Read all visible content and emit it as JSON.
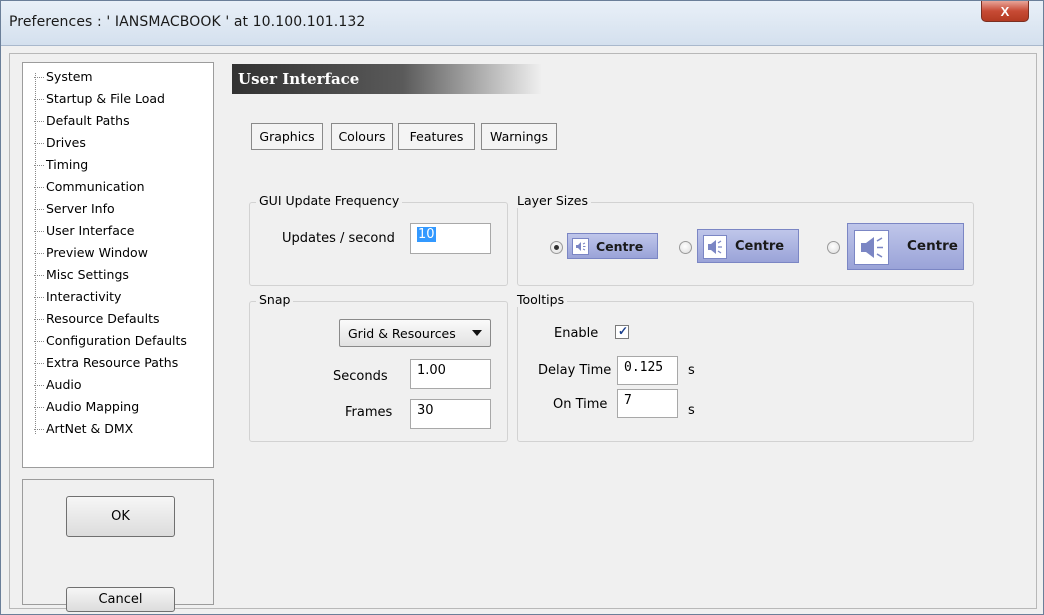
{
  "window": {
    "title": "Preferences  :  ' IANSMACBOOK '  at  10.100.101.132",
    "close_label": "X"
  },
  "tree": {
    "items": [
      "System",
      "Startup & File Load",
      "Default Paths",
      "Drives",
      "Timing",
      "Communication",
      "Server Info",
      "User Interface",
      "Preview Window",
      "Misc Settings",
      "Interactivity",
      "Resource Defaults",
      "Configuration Defaults",
      "Extra Resource Paths",
      "Audio",
      "Audio Mapping",
      "ArtNet & DMX"
    ]
  },
  "buttons": {
    "ok": "OK",
    "cancel": "Cancel"
  },
  "header": {
    "title": "User Interface"
  },
  "tabs": [
    {
      "label": "Graphics"
    },
    {
      "label": "Colours"
    },
    {
      "label": "Features"
    },
    {
      "label": "Warnings"
    }
  ],
  "gui_update": {
    "group_label": "GUI Update Frequency",
    "field_label": "Updates / second",
    "value": "10"
  },
  "layer_sizes": {
    "group_label": "Layer Sizes",
    "options": [
      {
        "label": "Centre",
        "selected": true
      },
      {
        "label": "Centre",
        "selected": false
      },
      {
        "label": "Centre",
        "selected": false
      }
    ]
  },
  "snap": {
    "group_label": "Snap",
    "mode": "Grid & Resources",
    "seconds_label": "Seconds",
    "seconds_value": "1.00",
    "frames_label": "Frames",
    "frames_value": "30"
  },
  "tooltips": {
    "group_label": "Tooltips",
    "enable_label": "Enable",
    "enabled": true,
    "delay_label": "Delay Time",
    "delay_value": "0.125",
    "delay_unit": "s",
    "on_time_label": "On Time",
    "on_time_value": "7",
    "on_time_unit": "s"
  },
  "colors": {
    "layer_accent": "#9aa3d8",
    "header_dark": "#323232",
    "close_red": "#c74b35"
  },
  "icons": {
    "layer_icon": "speaker-icon",
    "select_arrow": "triangle-down-icon",
    "close": "close-icon"
  }
}
